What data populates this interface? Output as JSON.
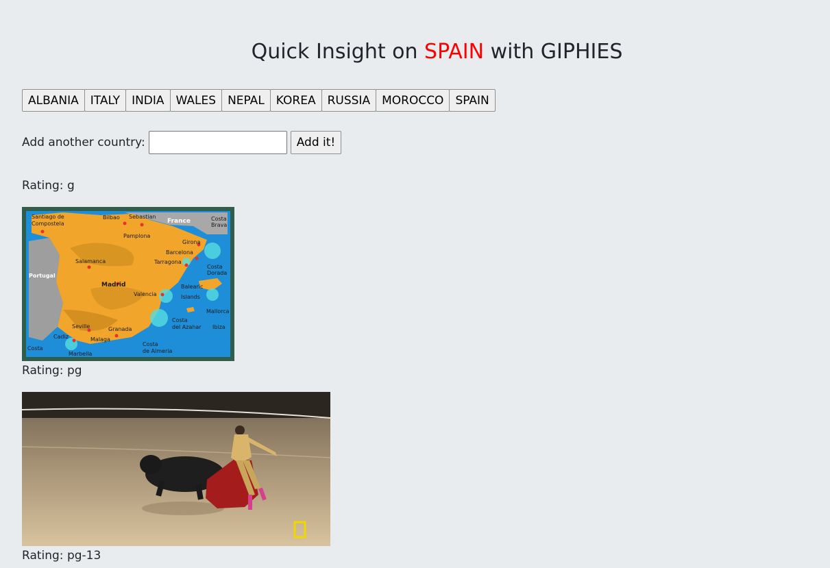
{
  "header": {
    "title_prefix": "Quick Insight on ",
    "title_country": "SPAIN",
    "title_suffix": " with GIPHIES",
    "country_color": "#ff0000"
  },
  "countries": [
    "ALBANIA",
    "ITALY",
    "INDIA",
    "WALES",
    "NEPAL",
    "KOREA",
    "RUSSIA",
    "MOROCCO",
    "SPAIN"
  ],
  "add_country": {
    "label": "Add another country:",
    "value": "",
    "button_label": "Add it!"
  },
  "gifs": [
    {
      "rating": "Rating: g"
    },
    {
      "rating": "Rating: pg"
    },
    {
      "rating": "Rating: pg-13"
    }
  ],
  "map_labels": {
    "santiago": "Santiago de",
    "compostela": "Compostela",
    "bilbao": "Bilbao",
    "sebastian": "Sebastian",
    "france": "France",
    "costa_brava1": "Costa",
    "costa_brava2": "Brava",
    "pamplona": "Pamplona",
    "girona": "Girona",
    "barcelona": "Barcelona",
    "salamanca": "Salamanca",
    "tarragona": "Tarragona",
    "costa_dorada1": "Costa",
    "costa_dorada2": "Dorada",
    "portugal": "Portugal",
    "madrid": "Madrid",
    "balearic1": "Balearic",
    "balearic2": "Islands",
    "valencia": "Valencia",
    "mallorca": "Mallorca",
    "costa_azahar1": "Costa",
    "costa_azahar2": "del Azahar",
    "ibiza": "Ibiza",
    "seville": "Seville",
    "granada": "Granada",
    "cadiz": "Cadiz",
    "malaga": "Malaga",
    "costa_almeria1": "Costa",
    "costa_almeria2": "de Almeria",
    "marbella": "Marbella",
    "costa_sol": "Costa"
  }
}
